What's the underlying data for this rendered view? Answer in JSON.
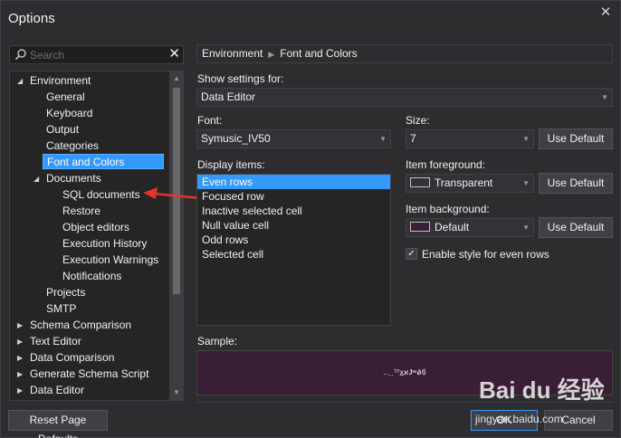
{
  "window": {
    "title": "Options",
    "close_glyph": "✕"
  },
  "search": {
    "placeholder": "Search",
    "clear_glyph": "✕"
  },
  "tree": {
    "items": [
      {
        "label": "Environment"
      },
      {
        "label": "General"
      },
      {
        "label": "Keyboard"
      },
      {
        "label": "Output"
      },
      {
        "label": "Categories"
      },
      {
        "label": "Font and Colors"
      },
      {
        "label": "Documents"
      },
      {
        "label": "SQL documents"
      },
      {
        "label": "Restore"
      },
      {
        "label": "Object editors"
      },
      {
        "label": "Execution History"
      },
      {
        "label": "Execution Warnings"
      },
      {
        "label": "Notifications"
      },
      {
        "label": "Projects"
      },
      {
        "label": "SMTP"
      },
      {
        "label": "Schema Comparison"
      },
      {
        "label": "Text Editor"
      },
      {
        "label": "Data Comparison"
      },
      {
        "label": "Generate Schema Script"
      },
      {
        "label": "Data Editor"
      }
    ],
    "selected": "Font and Colors"
  },
  "breadcrumb": {
    "part1": "Environment",
    "part2": "Font and Colors"
  },
  "show_settings": {
    "label": "Show settings for:",
    "value": "Data Editor"
  },
  "font": {
    "label": "Font:",
    "value": "Symusic_IV50"
  },
  "size": {
    "label": "Size:",
    "value": "7",
    "default_button": "Use Default"
  },
  "display_items": {
    "label": "Display items:",
    "items": [
      "Even rows",
      "Focused row",
      "Inactive selected cell",
      "Null value cell",
      "Odd rows",
      "Selected cell"
    ],
    "selected": "Even rows"
  },
  "item_foreground": {
    "label": "Item foreground:",
    "value": "Transparent",
    "default_button": "Use Default"
  },
  "item_background": {
    "label": "Item background:",
    "value": "Default",
    "default_button": "Use Default"
  },
  "enable_style": {
    "label": "Enable style for even rows",
    "checked": true,
    "check_glyph": "✓"
  },
  "sample": {
    "label": "Sample:",
    "text": "‥ˎˎˀˀx̲ϰɈʷǿб"
  },
  "footer": {
    "reset_button": "Reset Page Defaults",
    "ok_button": "OK",
    "cancel_button": "Cancel"
  },
  "watermark": {
    "text": "Bai du 经验",
    "sub": "jingyan.baidu.com"
  }
}
